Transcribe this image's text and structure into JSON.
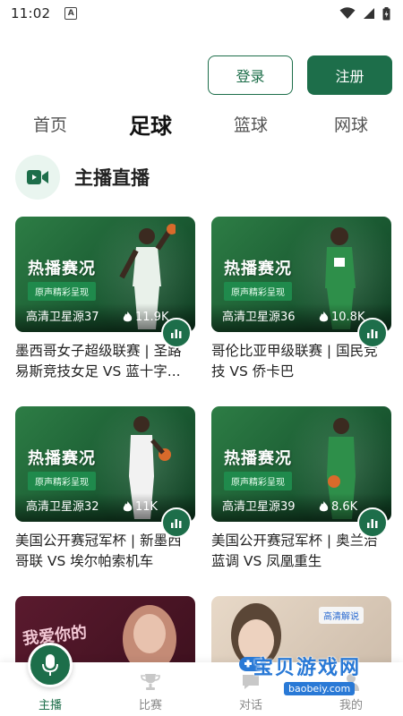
{
  "status_bar": {
    "time": "11:02",
    "notification_glyph": "A"
  },
  "auth": {
    "login_label": "登录",
    "register_label": "注册"
  },
  "tabs": [
    {
      "label": "首页",
      "active": false
    },
    {
      "label": "足球",
      "active": true
    },
    {
      "label": "篮球",
      "active": false
    },
    {
      "label": "网球",
      "active": false
    }
  ],
  "section": {
    "title": "主播直播",
    "icon": "video-camera-icon"
  },
  "cards": [
    {
      "hot_label": "热播赛况",
      "sub_label": "原声精彩呈现",
      "source": "高清卫星源37",
      "views": "11.9K",
      "title": "墨西哥女子超级联赛 | 圣路易斯竞技女足 VS 蓝十字..."
    },
    {
      "hot_label": "热播赛况",
      "sub_label": "原声精彩呈现",
      "source": "高清卫星源36",
      "views": "10.8K",
      "title": "哥伦比亚甲级联赛 | 国民竞技 VS 侨卡巴"
    },
    {
      "hot_label": "热播赛况",
      "sub_label": "原声精彩呈现",
      "source": "高清卫星源32",
      "views": "11K",
      "title": "美国公开赛冠军杯 | 新墨西哥联 VS 埃尔帕索机车"
    },
    {
      "hot_label": "热播赛况",
      "sub_label": "原声精彩呈现",
      "source": "高清卫星源39",
      "views": "8.6K",
      "title": "美国公开赛冠军杯 | 奥兰治蓝调 VS 凤凰重生"
    }
  ],
  "partial_cards": [
    {
      "text": "我爱你的"
    },
    {
      "tag": "高清解说"
    }
  ],
  "bottom_nav": [
    {
      "label": "主播",
      "icon": "microphone-icon",
      "active": true
    },
    {
      "label": "比赛",
      "icon": "trophy-icon",
      "active": false
    },
    {
      "label": "对话",
      "icon": "chat-icon",
      "active": false
    },
    {
      "label": "我的",
      "icon": "user-icon",
      "active": false
    }
  ],
  "watermark": {
    "main": "宝贝游戏网",
    "sub": "baobeiy.com"
  },
  "colors": {
    "brand_green": "#1d6e4a",
    "tab_active": "#111111",
    "tab_inactive": "#555555"
  }
}
